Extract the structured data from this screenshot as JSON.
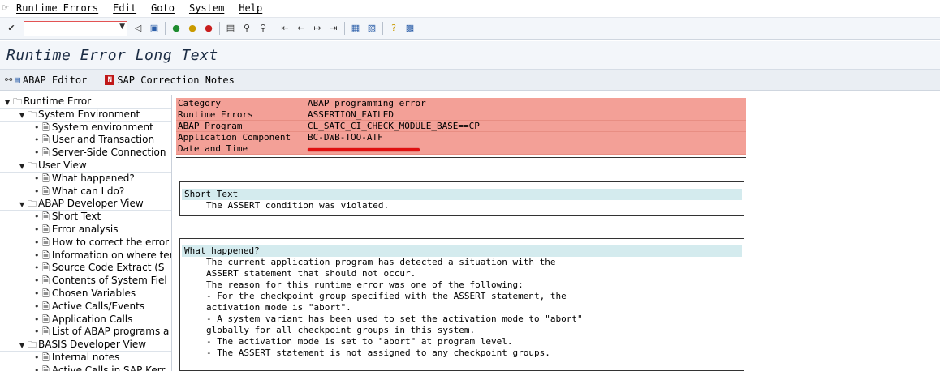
{
  "menubar": {
    "items": [
      "Runtime Errors",
      "Edit",
      "Goto",
      "System",
      "Help"
    ]
  },
  "toolbar": {
    "command_value": "",
    "icons": [
      "enter-icon",
      "back-icon",
      "save-icon",
      "back-nav-icon",
      "exit-icon",
      "cancel-icon",
      "print-icon",
      "find-icon",
      "find-next-icon",
      "first-page-icon",
      "prev-page-icon",
      "next-page-icon",
      "last-page-icon",
      "new-session-icon",
      "shortcut-icon",
      "help-icon",
      "layout-icon"
    ]
  },
  "title": "Runtime Error Long Text",
  "app_toolbar": {
    "abap_editor": "ABAP Editor",
    "sap_correction_notes": "SAP Correction Notes"
  },
  "tree": {
    "items": [
      {
        "type": "folder",
        "level": 0,
        "label": "Runtime Error"
      },
      {
        "type": "folder",
        "level": 1,
        "label": "System Environment"
      },
      {
        "type": "doc",
        "level": 2,
        "label": "System environment"
      },
      {
        "type": "doc",
        "level": 2,
        "label": "User and Transaction"
      },
      {
        "type": "doc",
        "level": 2,
        "label": "Server-Side Connection"
      },
      {
        "type": "folder",
        "level": 1,
        "label": "User View"
      },
      {
        "type": "doc",
        "level": 2,
        "label": "What happened?"
      },
      {
        "type": "doc",
        "level": 2,
        "label": "What can I do?"
      },
      {
        "type": "folder",
        "level": 1,
        "label": "ABAP Developer View"
      },
      {
        "type": "doc",
        "level": 2,
        "label": "Short Text"
      },
      {
        "type": "doc",
        "level": 2,
        "label": "Error analysis"
      },
      {
        "type": "doc",
        "level": 2,
        "label": "How to correct the error"
      },
      {
        "type": "doc",
        "level": 2,
        "label": "Information on where ter"
      },
      {
        "type": "doc",
        "level": 2,
        "label": "Source Code Extract (S"
      },
      {
        "type": "doc",
        "level": 2,
        "label": "Contents of System Fiel"
      },
      {
        "type": "doc",
        "level": 2,
        "label": "Chosen Variables"
      },
      {
        "type": "doc",
        "level": 2,
        "label": "Active Calls/Events"
      },
      {
        "type": "doc",
        "level": 2,
        "label": "Application Calls"
      },
      {
        "type": "doc",
        "level": 2,
        "label": "List of ABAP programs a"
      },
      {
        "type": "folder",
        "level": 1,
        "label": "BASIS Developer View"
      },
      {
        "type": "doc",
        "level": 2,
        "label": "Internal notes"
      },
      {
        "type": "doc",
        "level": 2,
        "label": "Active Calls in SAP Kerr"
      }
    ]
  },
  "header": {
    "rows": [
      {
        "key": "Category",
        "value": "ABAP programming error"
      },
      {
        "key": "Runtime Errors",
        "value": "ASSERTION_FAILED"
      },
      {
        "key": "ABAP Program",
        "value": "CL_SATC_CI_CHECK_MODULE_BASE==CP"
      },
      {
        "key": "Application Component",
        "value": "BC-DWB-TOO-ATF"
      },
      {
        "key": "Date and Time",
        "value": ""
      }
    ]
  },
  "short_text": {
    "heading": "Short Text",
    "lines": [
      "The ASSERT condition was violated."
    ]
  },
  "what_happened": {
    "heading": "What happened?",
    "lines": [
      "The current application program has detected a situation with the",
      "ASSERT statement that should not occur.",
      "The reason for this runtime error was one of the following:",
      "- For the checkpoint group specified with the ASSERT statement, the",
      "activation mode is \"abort\".",
      "- A system variant has been used to set the activation mode to \"abort\"",
      "globally for all checkpoint groups in this system.",
      "- The activation mode is set to \"abort\" at program level.",
      "- The ASSERT statement is not assigned to any checkpoint groups."
    ]
  }
}
